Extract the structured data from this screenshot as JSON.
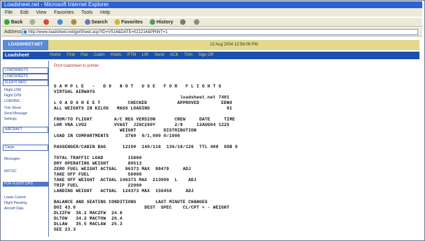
{
  "window": {
    "title": "Loadsheet.net - Microsoft Internet Explorer"
  },
  "menu": [
    "File",
    "Edit",
    "View",
    "Favorites",
    "Tools",
    "Help"
  ],
  "toolbar": {
    "back": "Back",
    "search": "Search",
    "favorites": "Favorites",
    "history": "History"
  },
  "address": {
    "label": "Address",
    "url": "http://www.loadsheet.net/getSheet.asp?ID=VS14&DATE=021214&PRINT=1"
  },
  "site": {
    "logo": "LOADSHEET.NET",
    "date": "12 Aug 2004 12:56:08 PM",
    "brand": "Loadsheet",
    "nav": [
      "Home",
      "Find",
      "Pax",
      "Cabin",
      "Holds",
      "PTM",
      "LIR",
      "Send",
      "ACK",
      "Trim",
      "Sign Off"
    ]
  },
  "sidebar": [
    "LOADSHEETS",
    "LOADSHEETS",
    "FLIGHT INFO",
    "Flight LDM",
    "Flight CPM",
    "LOADING",
    "Trim Sheet",
    "Send Message",
    "Settings",
    "AIRCRAFT",
    "Cargo",
    "Messages",
    "NOTOC",
    "FOR FLIGHT OPS",
    "Loads Control",
    "Flight Planning",
    "Aircraft Data"
  ],
  "print_link": "Print loadsheet to printer",
  "loadsheet_lines": [
    "S A M P L E   -   D O   N O T   U S E   F O R   F L I G H T S",
    "VIRTUAL AIRWAYS",
    "                                              loadsheet.net 7401",
    "L O A D S H E E T          CHECKED           APPROVED        EDNO",
    "ALL WEIGHTS IN KILOS   MASS LOADING                            01",
    "",
    "FROM/TO FLIGHT        A/C REG VERSION       CREW     DATE     TIME",
    "LHR VNA LVO2          VVAST  J28C260Y       2/9     12AUG04 1225",
    "                        WEIGHT          DISTRIBUTION",
    "LOAD IN COMPARTMENTS      3760  0/1,000 0/1000",
    "",
    "PASSENGER/CABIN BAG      12100  140/116  136/18/126  TTL 409  SOB 0",
    "",
    "TOTAL TRAFFIC LOAD         15860",
    "DRY OPERATING WEIGHT       80513",
    "ZERO FUEL WEIGHT ACTUAL   96373 MAX  99479     ADJ",
    "TAKE OFF FUEL              50000",
    "TAKE OFF WEIGHT  ACTUAL 146373 MAX  213000  L    ADJ",
    "TRIP FUEL                  22000",
    "LANDING WEIGHT   ACTUAL  124373 MAX  156458     ADJ",
    "",
    "BALANCE AND SEATING CONDITIONS       LAST MINUTE CHANGES",
    "DOI 43.0                         DEST  SPEC    CL/CPT + - WEIGHT",
    "DLIZFW  36.2 MACZFW  24.6",
    "DLTOW   34.2 MACTOW  26.4",
    "DLLAW   35.5 MACLAW  25.3",
    "SEE 23.3"
  ]
}
